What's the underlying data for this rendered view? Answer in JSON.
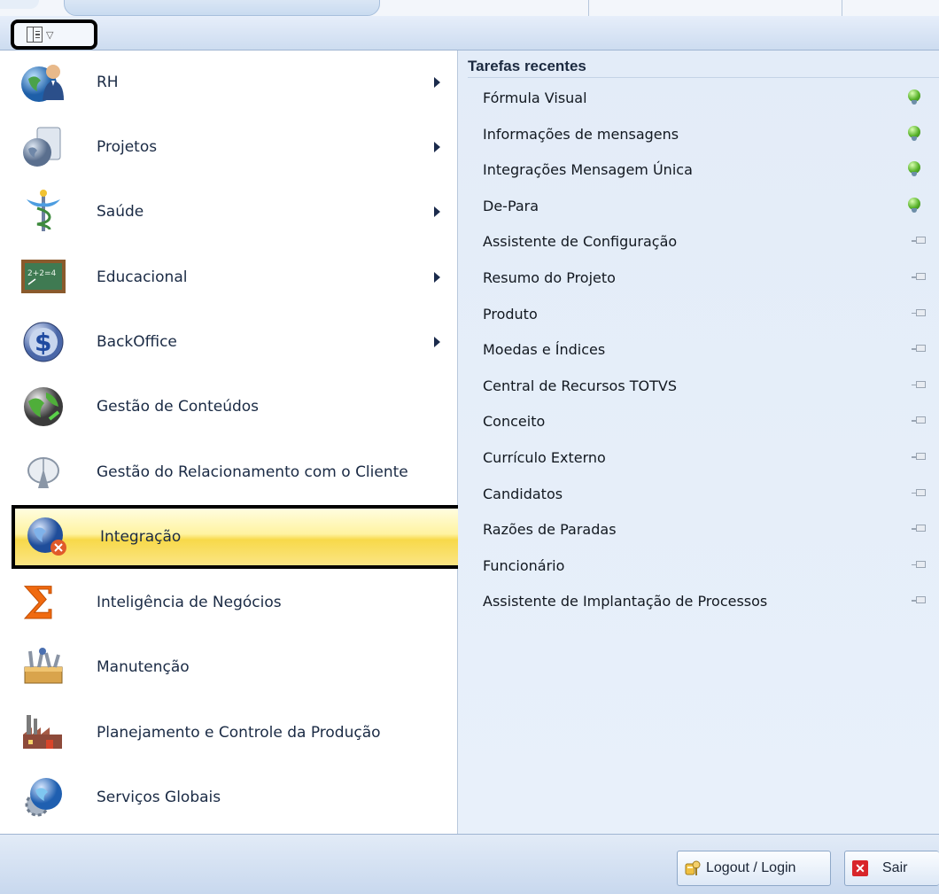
{
  "header": {
    "menu_icon": "panel-menu-icon"
  },
  "modules": [
    {
      "label": "RH",
      "icon": "hr-person-globe-icon",
      "has_submenu": true
    },
    {
      "label": "Projetos",
      "icon": "projects-globe-icon",
      "has_submenu": true
    },
    {
      "label": "Saúde",
      "icon": "health-caduceus-icon",
      "has_submenu": true
    },
    {
      "label": "Educacional",
      "icon": "education-chalkboard-icon",
      "has_submenu": true
    },
    {
      "label": "BackOffice",
      "icon": "dollar-coin-icon",
      "has_submenu": true
    },
    {
      "label": "Gestão de Conteúdos",
      "icon": "content-globe-icon",
      "has_submenu": false
    },
    {
      "label": "Gestão do Relacionamento com o Cliente",
      "icon": "crm-satellite-icon",
      "has_submenu": false
    },
    {
      "label": "Integração",
      "icon": "integration-globe-icon",
      "has_submenu": false,
      "selected": true
    },
    {
      "label": "Inteligência de Negócios",
      "icon": "sigma-icon",
      "has_submenu": false
    },
    {
      "label": "Manutenção",
      "icon": "maintenance-toolbox-icon",
      "has_submenu": false
    },
    {
      "label": "Planejamento e Controle da Produção",
      "icon": "factory-icon",
      "has_submenu": false
    },
    {
      "label": "Serviços Globais",
      "icon": "global-services-gear-icon",
      "has_submenu": false
    }
  ],
  "recent": {
    "title": "Tarefas recentes",
    "items": [
      {
        "label": "Fórmula Visual",
        "pinned": true
      },
      {
        "label": "Informações de mensagens",
        "pinned": true
      },
      {
        "label": "Integrações Mensagem Única",
        "pinned": true
      },
      {
        "label": "De-Para",
        "pinned": true
      },
      {
        "label": "Assistente de Configuração",
        "pinned": false
      },
      {
        "label": "Resumo do Projeto",
        "pinned": false
      },
      {
        "label": "Produto",
        "pinned": false
      },
      {
        "label": "Moedas e Índices",
        "pinned": false
      },
      {
        "label": "Central de Recursos TOTVS",
        "pinned": false
      },
      {
        "label": "Conceito",
        "pinned": false
      },
      {
        "label": "Currículo Externo",
        "pinned": false
      },
      {
        "label": "Candidatos",
        "pinned": false
      },
      {
        "label": "Razões de Paradas",
        "pinned": false
      },
      {
        "label": "Funcionário",
        "pinned": false
      },
      {
        "label": "Assistente de Implantação de Processos",
        "pinned": false
      }
    ]
  },
  "footer": {
    "logout_label": "Logout / Login",
    "exit_label": "Sair"
  }
}
